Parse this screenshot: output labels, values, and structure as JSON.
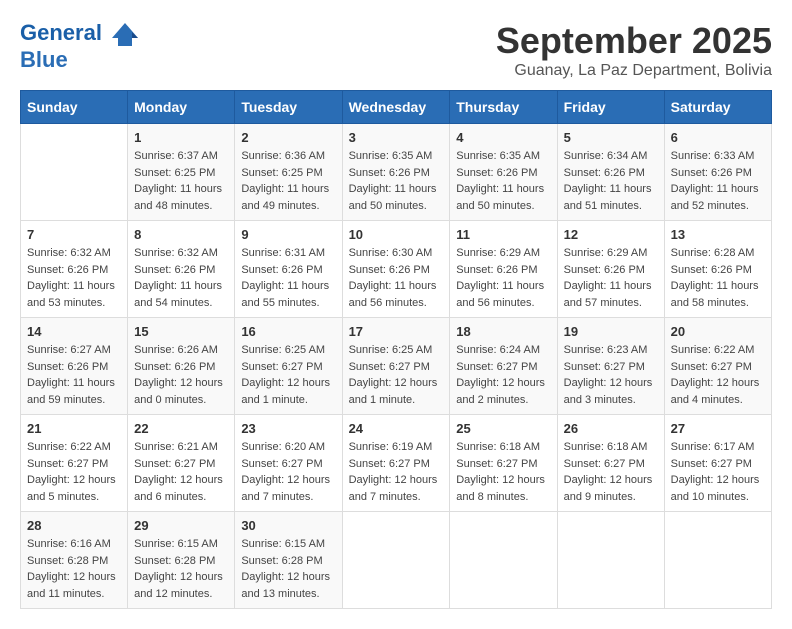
{
  "header": {
    "logo_line1": "General",
    "logo_line2": "Blue",
    "month_title": "September 2025",
    "subtitle": "Guanay, La Paz Department, Bolivia"
  },
  "days_of_week": [
    "Sunday",
    "Monday",
    "Tuesday",
    "Wednesday",
    "Thursday",
    "Friday",
    "Saturday"
  ],
  "weeks": [
    [
      {
        "num": "",
        "info": ""
      },
      {
        "num": "1",
        "info": "Sunrise: 6:37 AM\nSunset: 6:25 PM\nDaylight: 11 hours\nand 48 minutes."
      },
      {
        "num": "2",
        "info": "Sunrise: 6:36 AM\nSunset: 6:25 PM\nDaylight: 11 hours\nand 49 minutes."
      },
      {
        "num": "3",
        "info": "Sunrise: 6:35 AM\nSunset: 6:26 PM\nDaylight: 11 hours\nand 50 minutes."
      },
      {
        "num": "4",
        "info": "Sunrise: 6:35 AM\nSunset: 6:26 PM\nDaylight: 11 hours\nand 50 minutes."
      },
      {
        "num": "5",
        "info": "Sunrise: 6:34 AM\nSunset: 6:26 PM\nDaylight: 11 hours\nand 51 minutes."
      },
      {
        "num": "6",
        "info": "Sunrise: 6:33 AM\nSunset: 6:26 PM\nDaylight: 11 hours\nand 52 minutes."
      }
    ],
    [
      {
        "num": "7",
        "info": "Sunrise: 6:32 AM\nSunset: 6:26 PM\nDaylight: 11 hours\nand 53 minutes."
      },
      {
        "num": "8",
        "info": "Sunrise: 6:32 AM\nSunset: 6:26 PM\nDaylight: 11 hours\nand 54 minutes."
      },
      {
        "num": "9",
        "info": "Sunrise: 6:31 AM\nSunset: 6:26 PM\nDaylight: 11 hours\nand 55 minutes."
      },
      {
        "num": "10",
        "info": "Sunrise: 6:30 AM\nSunset: 6:26 PM\nDaylight: 11 hours\nand 56 minutes."
      },
      {
        "num": "11",
        "info": "Sunrise: 6:29 AM\nSunset: 6:26 PM\nDaylight: 11 hours\nand 56 minutes."
      },
      {
        "num": "12",
        "info": "Sunrise: 6:29 AM\nSunset: 6:26 PM\nDaylight: 11 hours\nand 57 minutes."
      },
      {
        "num": "13",
        "info": "Sunrise: 6:28 AM\nSunset: 6:26 PM\nDaylight: 11 hours\nand 58 minutes."
      }
    ],
    [
      {
        "num": "14",
        "info": "Sunrise: 6:27 AM\nSunset: 6:26 PM\nDaylight: 11 hours\nand 59 minutes."
      },
      {
        "num": "15",
        "info": "Sunrise: 6:26 AM\nSunset: 6:26 PM\nDaylight: 12 hours\nand 0 minutes."
      },
      {
        "num": "16",
        "info": "Sunrise: 6:25 AM\nSunset: 6:27 PM\nDaylight: 12 hours\nand 1 minute."
      },
      {
        "num": "17",
        "info": "Sunrise: 6:25 AM\nSunset: 6:27 PM\nDaylight: 12 hours\nand 1 minute."
      },
      {
        "num": "18",
        "info": "Sunrise: 6:24 AM\nSunset: 6:27 PM\nDaylight: 12 hours\nand 2 minutes."
      },
      {
        "num": "19",
        "info": "Sunrise: 6:23 AM\nSunset: 6:27 PM\nDaylight: 12 hours\nand 3 minutes."
      },
      {
        "num": "20",
        "info": "Sunrise: 6:22 AM\nSunset: 6:27 PM\nDaylight: 12 hours\nand 4 minutes."
      }
    ],
    [
      {
        "num": "21",
        "info": "Sunrise: 6:22 AM\nSunset: 6:27 PM\nDaylight: 12 hours\nand 5 minutes."
      },
      {
        "num": "22",
        "info": "Sunrise: 6:21 AM\nSunset: 6:27 PM\nDaylight: 12 hours\nand 6 minutes."
      },
      {
        "num": "23",
        "info": "Sunrise: 6:20 AM\nSunset: 6:27 PM\nDaylight: 12 hours\nand 7 minutes."
      },
      {
        "num": "24",
        "info": "Sunrise: 6:19 AM\nSunset: 6:27 PM\nDaylight: 12 hours\nand 7 minutes."
      },
      {
        "num": "25",
        "info": "Sunrise: 6:18 AM\nSunset: 6:27 PM\nDaylight: 12 hours\nand 8 minutes."
      },
      {
        "num": "26",
        "info": "Sunrise: 6:18 AM\nSunset: 6:27 PM\nDaylight: 12 hours\nand 9 minutes."
      },
      {
        "num": "27",
        "info": "Sunrise: 6:17 AM\nSunset: 6:27 PM\nDaylight: 12 hours\nand 10 minutes."
      }
    ],
    [
      {
        "num": "28",
        "info": "Sunrise: 6:16 AM\nSunset: 6:28 PM\nDaylight: 12 hours\nand 11 minutes."
      },
      {
        "num": "29",
        "info": "Sunrise: 6:15 AM\nSunset: 6:28 PM\nDaylight: 12 hours\nand 12 minutes."
      },
      {
        "num": "30",
        "info": "Sunrise: 6:15 AM\nSunset: 6:28 PM\nDaylight: 12 hours\nand 13 minutes."
      },
      {
        "num": "",
        "info": ""
      },
      {
        "num": "",
        "info": ""
      },
      {
        "num": "",
        "info": ""
      },
      {
        "num": "",
        "info": ""
      }
    ]
  ]
}
